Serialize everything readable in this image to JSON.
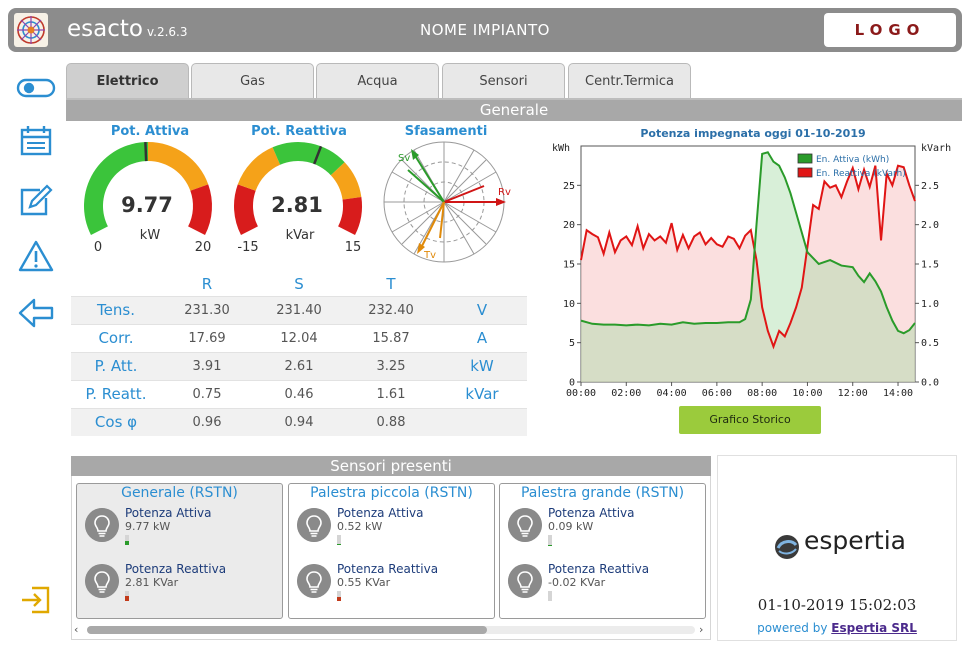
{
  "header": {
    "app_name": "esacto",
    "version": "v.2.6.3",
    "plant_name": "NOME IMPIANTO",
    "logo_text": "LOGO"
  },
  "sidebar": {
    "items": [
      {
        "icon": "toggle-icon"
      },
      {
        "icon": "dashboard-icon"
      },
      {
        "icon": "edit-icon"
      },
      {
        "icon": "warning-icon"
      },
      {
        "icon": "back-arrow-icon"
      },
      {
        "icon": "login-icon"
      }
    ]
  },
  "tabs": [
    {
      "label": "Elettrico",
      "active": true
    },
    {
      "label": "Gas"
    },
    {
      "label": "Acqua"
    },
    {
      "label": "Sensori"
    },
    {
      "label": "Centr.Termica"
    }
  ],
  "general": {
    "title": "Generale",
    "gauges": [
      {
        "title": "Pot. Attiva",
        "value": "9.77",
        "unit": "kW",
        "min": "0",
        "max": "20",
        "value_fraction": 0.49
      },
      {
        "title": "Pot. Reattiva",
        "value": "2.81",
        "unit": "kVar",
        "min": "-15",
        "max": "15",
        "value_fraction": 0.59
      }
    ],
    "phasor": {
      "title": "Sfasamenti",
      "labels": [
        "Sv",
        "Rv",
        "Tv"
      ]
    }
  },
  "measures": {
    "columns": [
      "R",
      "S",
      "T"
    ],
    "rows": [
      {
        "label": "Tens.",
        "values": [
          "231.30",
          "231.40",
          "232.40"
        ],
        "unit": "V"
      },
      {
        "label": "Corr.",
        "values": [
          "17.69",
          "12.04",
          "15.87"
        ],
        "unit": "A"
      },
      {
        "label": "P. Att.",
        "values": [
          "3.91",
          "2.61",
          "3.25"
        ],
        "unit": "kW"
      },
      {
        "label": "P. Reatt.",
        "values": [
          "0.75",
          "0.46",
          "1.61"
        ],
        "unit": "kVar"
      },
      {
        "label": "Cos φ",
        "values": [
          "0.96",
          "0.94",
          "0.88"
        ],
        "unit": ""
      }
    ]
  },
  "chart_data": {
    "type": "area",
    "title": "Potenza impegnata oggi 01-10-2019",
    "ylabel_left": "kWh",
    "ylabel_right": "kVarh",
    "x_ticks": [
      "00:00",
      "02:00",
      "04:00",
      "06:00",
      "08:00",
      "10:00",
      "12:00",
      "14:00"
    ],
    "y_ticks_left": [
      "0",
      "5",
      "10",
      "15",
      "20",
      "25"
    ],
    "y_ticks_right": [
      "0.0",
      "0.5",
      "1.0",
      "1.5",
      "2.0",
      "2.5"
    ],
    "ylim_left": [
      0,
      30
    ],
    "ylim_right": [
      0,
      3.0
    ],
    "xlim_hours": [
      0,
      14.75
    ],
    "legend_position": "top-right",
    "series": [
      {
        "name": "En. Attiva (kWh)",
        "axis": "left",
        "color": "#2a9b2a",
        "x": [
          0,
          0.5,
          1,
          1.5,
          2,
          2.5,
          3,
          3.5,
          4,
          4.5,
          5,
          5.5,
          6,
          6.5,
          7,
          7.25,
          7.5,
          7.75,
          8,
          8.25,
          8.5,
          8.75,
          9,
          9.25,
          9.5,
          9.75,
          10,
          10.5,
          11,
          11.5,
          12,
          12.25,
          12.5,
          12.75,
          13,
          13.25,
          13.5,
          13.75,
          14,
          14.25,
          14.5,
          14.75
        ],
        "values": [
          7.8,
          7.4,
          7.3,
          7.3,
          7.2,
          7.3,
          7.2,
          7.4,
          7.3,
          7.6,
          7.4,
          7.5,
          7.5,
          7.6,
          7.6,
          8.0,
          10.5,
          20,
          29,
          29.2,
          28,
          27.5,
          26,
          24,
          21.5,
          19,
          16.5,
          15,
          15.5,
          14.8,
          14.6,
          13.5,
          12.7,
          13.8,
          12.8,
          11.5,
          9.5,
          7.8,
          6.5,
          6.2,
          6.6,
          7.5
        ]
      },
      {
        "name": "En. Reattiva (kVarh)",
        "axis": "right",
        "color": "#e01515",
        "x": [
          0,
          0.25,
          0.5,
          0.75,
          1,
          1.25,
          1.5,
          1.75,
          2,
          2.25,
          2.5,
          2.75,
          3,
          3.25,
          3.5,
          3.75,
          4,
          4.25,
          4.5,
          4.75,
          5,
          5.25,
          5.5,
          5.75,
          6,
          6.25,
          6.5,
          6.75,
          7,
          7.25,
          7.5,
          7.75,
          8,
          8.25,
          8.5,
          8.75,
          9,
          9.25,
          9.5,
          9.75,
          10,
          10.25,
          10.5,
          10.75,
          11,
          11.25,
          11.5,
          11.75,
          12,
          12.25,
          12.5,
          12.75,
          13,
          13.25,
          13.5,
          13.75,
          14,
          14.25,
          14.5,
          14.75
        ],
        "values": [
          1.55,
          1.93,
          1.88,
          1.84,
          1.63,
          1.9,
          1.65,
          1.8,
          1.85,
          1.74,
          1.98,
          1.7,
          1.88,
          1.8,
          1.85,
          1.77,
          2.02,
          1.68,
          1.87,
          1.7,
          1.85,
          1.9,
          1.75,
          1.83,
          1.75,
          1.72,
          1.85,
          1.82,
          1.7,
          1.86,
          1.93,
          1.55,
          0.95,
          0.65,
          0.45,
          0.65,
          0.58,
          0.75,
          0.95,
          1.2,
          1.72,
          2.25,
          2.2,
          2.55,
          2.47,
          2.5,
          2.35,
          2.55,
          2.72,
          2.45,
          2.7,
          2.48,
          2.75,
          1.8,
          2.65,
          2.5,
          2.75,
          2.73,
          2.5,
          2.3
        ]
      }
    ]
  },
  "history_button": "Grafico Storico",
  "sensors": {
    "title": "Sensori presenti",
    "cards": [
      {
        "title": "Generale (RSTN)",
        "selected": true,
        "rows": [
          {
            "label": "Potenza Attiva",
            "value": "9.77 kW",
            "level": 0.45,
            "color": "#2a9b2a"
          },
          {
            "label": "Potenza Reattiva",
            "value": "2.81 KVar",
            "level": 0.5,
            "color": "#c23a1a"
          }
        ]
      },
      {
        "title": "Palestra piccola (RSTN)",
        "selected": false,
        "rows": [
          {
            "label": "Potenza Attiva",
            "value": "0.52 kW",
            "level": 0.15,
            "color": "#2a9b2a"
          },
          {
            "label": "Potenza Reattiva",
            "value": "0.55 KVar",
            "level": 0.45,
            "color": "#c23a1a"
          }
        ]
      },
      {
        "title": "Palestra grande (RSTN)",
        "selected": false,
        "rows": [
          {
            "label": "Potenza Attiva",
            "value": "0.09 kW",
            "level": 0.05,
            "color": "#2a9b2a"
          },
          {
            "label": "Potenza Reattiva",
            "value": "-0.02 KVar",
            "level": 0.0,
            "color": "#c23a1a"
          }
        ]
      }
    ]
  },
  "info": {
    "brand": "espertia",
    "datetime": "01-10-2019  15:02:03",
    "powered_by": "powered by",
    "company": "Espertia SRL"
  }
}
